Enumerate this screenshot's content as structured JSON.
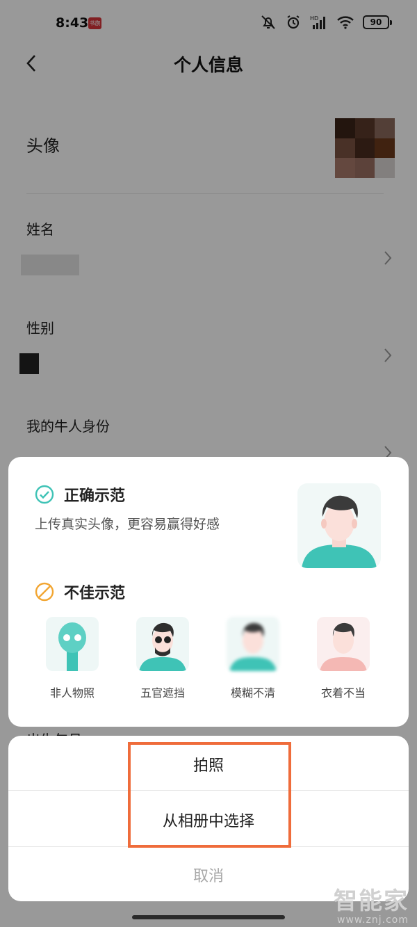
{
  "status_bar": {
    "time": "8:43",
    "badge": "书旗",
    "battery": "90"
  },
  "header": {
    "title": "个人信息"
  },
  "profile": {
    "avatar_label": "头像",
    "name_label": "姓名",
    "gender_label": "性别",
    "identity_label": "我的牛人身份",
    "birthday_label": "出生年月"
  },
  "guide": {
    "correct_title": "正确示范",
    "correct_desc": "上传真实头像，更容易赢得好感",
    "bad_title": "不佳示范",
    "bad_examples": [
      "非人物照",
      "五官遮挡",
      "模糊不清",
      "衣着不当"
    ]
  },
  "action_sheet": {
    "take_photo": "拍照",
    "from_album": "从相册中选择",
    "cancel": "取消"
  },
  "watermark": {
    "title": "智能家",
    "url": "www.znj.com"
  },
  "colors": {
    "accent": "#ef6c3b",
    "teal": "#3fc3b6",
    "warning": "#f2a633"
  }
}
